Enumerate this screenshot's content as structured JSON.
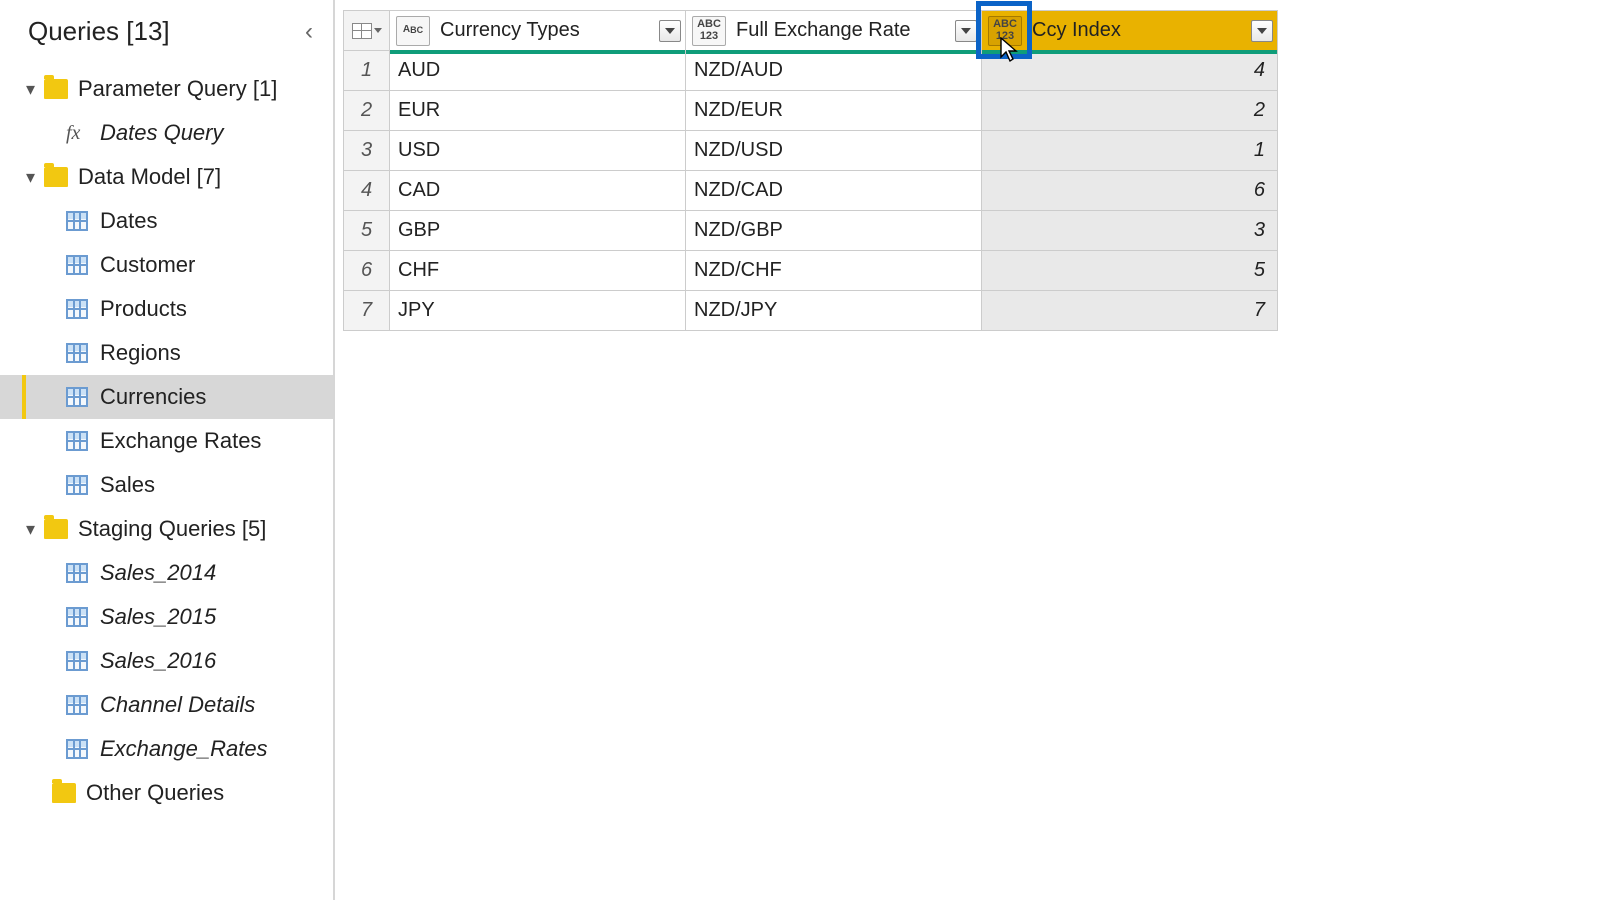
{
  "panel": {
    "title": "Queries [13]"
  },
  "groups": {
    "param": {
      "label": "Parameter Query [1]"
    },
    "model": {
      "label": "Data Model [7]"
    },
    "staging": {
      "label": "Staging Queries [5]"
    },
    "other": {
      "label": "Other Queries"
    }
  },
  "queries": {
    "dates_query": "Dates Query",
    "dates": "Dates",
    "customer": "Customer",
    "products": "Products",
    "regions": "Regions",
    "currencies": "Currencies",
    "exchange_rates": "Exchange Rates",
    "sales": "Sales",
    "sales_2014": "Sales_2014",
    "sales_2015": "Sales_2015",
    "sales_2016": "Sales_2016",
    "channel_details": "Channel Details",
    "exchange_rates_stg": "Exchange_Rates"
  },
  "columns": {
    "c1": {
      "label": "Currency Types",
      "type_icon": "ABC"
    },
    "c2": {
      "label": "Full Exchange Rate",
      "type_icon": "ABC\n123"
    },
    "c3": {
      "label": "Ccy Index",
      "type_icon": "ABC\n123"
    }
  },
  "rows": [
    {
      "n": "1",
      "ct": "AUD",
      "fx": "NZD/AUD",
      "ci": "4"
    },
    {
      "n": "2",
      "ct": "EUR",
      "fx": "NZD/EUR",
      "ci": "2"
    },
    {
      "n": "3",
      "ct": "USD",
      "fx": "NZD/USD",
      "ci": "1"
    },
    {
      "n": "4",
      "ct": "CAD",
      "fx": "NZD/CAD",
      "ci": "6"
    },
    {
      "n": "5",
      "ct": "GBP",
      "fx": "NZD/GBP",
      "ci": "3"
    },
    {
      "n": "6",
      "ct": "CHF",
      "fx": "NZD/CHF",
      "ci": "5"
    },
    {
      "n": "7",
      "ct": "JPY",
      "fx": "NZD/JPY",
      "ci": "7"
    }
  ]
}
